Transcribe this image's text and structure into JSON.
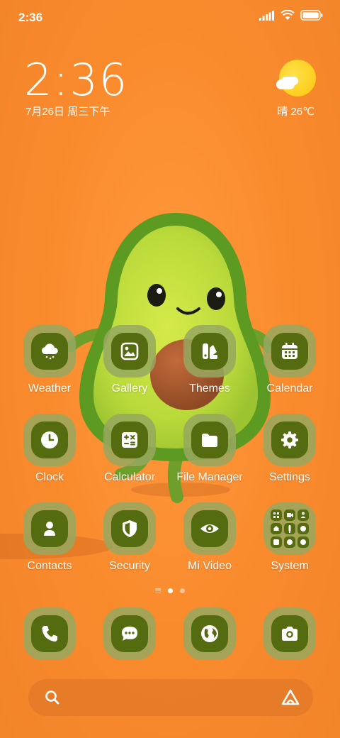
{
  "status_bar": {
    "time": "2:36"
  },
  "lockclock": {
    "time": "2:36",
    "date": "7月26日 周三下午"
  },
  "weather": {
    "text": "晴 26℃"
  },
  "apps": [
    {
      "label": "Weather",
      "icon": "weather-icon"
    },
    {
      "label": "Gallery",
      "icon": "gallery-icon"
    },
    {
      "label": "Themes",
      "icon": "themes-icon"
    },
    {
      "label": "Calendar",
      "icon": "calendar-icon"
    },
    {
      "label": "Clock",
      "icon": "clock-icon"
    },
    {
      "label": "Calculator",
      "icon": "calculator-icon"
    },
    {
      "label": "File Manager",
      "icon": "folder-icon"
    },
    {
      "label": "Settings",
      "icon": "gear-icon"
    },
    {
      "label": "Contacts",
      "icon": "contacts-icon"
    },
    {
      "label": "Security",
      "icon": "shield-icon"
    },
    {
      "label": "Mi Video",
      "icon": "eye-icon"
    },
    {
      "label": "System",
      "icon": "folder-grid-icon"
    }
  ],
  "dock": [
    {
      "icon": "phone-icon"
    },
    {
      "icon": "message-icon"
    },
    {
      "icon": "browser-icon"
    },
    {
      "icon": "camera-icon"
    }
  ],
  "pager": {
    "pages": 2,
    "current": 1
  },
  "colors": {
    "background": "#f98a2c",
    "icon_inner": "#556b10",
    "icon_outer": "#96a85f",
    "sun": "#fcc50b"
  }
}
